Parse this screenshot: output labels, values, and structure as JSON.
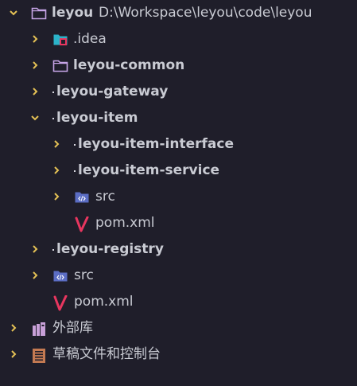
{
  "colors": {
    "background": "#1f1e2a",
    "text": "#c9cbd3",
    "arrow": "#e4c155",
    "folder": "#c6a4e6",
    "source_folder": "#5b6dc4",
    "maven": "#e8365f",
    "idea_folder": "#2bb3c9",
    "library": "#c8a0d8",
    "scratch": "#c47a52"
  },
  "project": {
    "root": {
      "label": "leyou",
      "path": "D:\\Workspace\\leyou\\code\\leyou"
    },
    "idea": {
      "label": ".idea"
    },
    "common": {
      "label": "leyou-common"
    },
    "gateway": {
      "label": "leyou-gateway"
    },
    "item": {
      "label": "leyou-item",
      "interface": {
        "label": "leyou-item-interface"
      },
      "service": {
        "label": "leyou-item-service"
      },
      "src": {
        "label": "src"
      },
      "pom": {
        "label": "pom.xml"
      }
    },
    "registry": {
      "label": "leyou-registry"
    },
    "src": {
      "label": "src"
    },
    "pom": {
      "label": "pom.xml"
    }
  },
  "external_libraries": {
    "label": "外部库"
  },
  "scratches": {
    "label": "草稿文件和控制台"
  }
}
